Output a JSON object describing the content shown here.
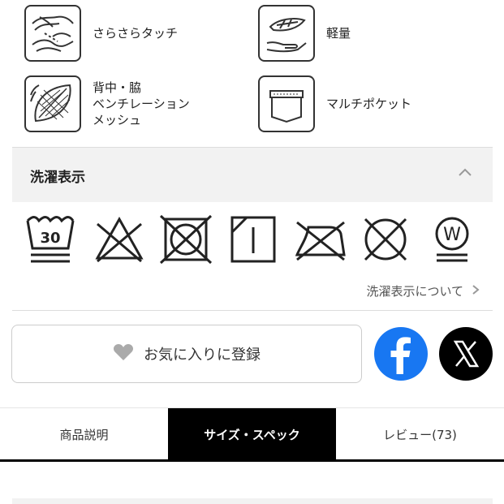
{
  "features": [
    {
      "icon": "smooth-touch-icon",
      "label": "さらさらタッチ"
    },
    {
      "icon": "lightweight-icon",
      "label": "軽量"
    },
    {
      "icon": "mesh-ventilation-icon",
      "label": "背中・脇\nベンチレーション\nメッシュ"
    },
    {
      "icon": "multi-pocket-icon",
      "label": "マルチポケット"
    }
  ],
  "wash_section": {
    "title": "洗濯表示",
    "expanded": true,
    "care_symbols": [
      {
        "icon": "wash-30-icon",
        "text": "30"
      },
      {
        "icon": "no-bleach-icon"
      },
      {
        "icon": "no-tumble-dry-icon"
      },
      {
        "icon": "line-dry-shade-icon"
      },
      {
        "icon": "no-iron-icon"
      },
      {
        "icon": "no-dry-clean-icon"
      },
      {
        "icon": "wet-clean-icon",
        "text": "W"
      }
    ],
    "link_label": "洗濯表示について"
  },
  "favorite_button": {
    "label": "お気に入りに登録",
    "icon": "heart-icon"
  },
  "social": [
    {
      "name": "facebook",
      "icon": "facebook-icon",
      "color": "#1877f2"
    },
    {
      "name": "x",
      "icon": "x-icon",
      "color": "#000000"
    }
  ],
  "tabs": [
    {
      "label": "商品説明",
      "active": false
    },
    {
      "label": "サイズ・スペック",
      "active": true
    },
    {
      "label": "レビュー(73)",
      "active": false
    }
  ]
}
